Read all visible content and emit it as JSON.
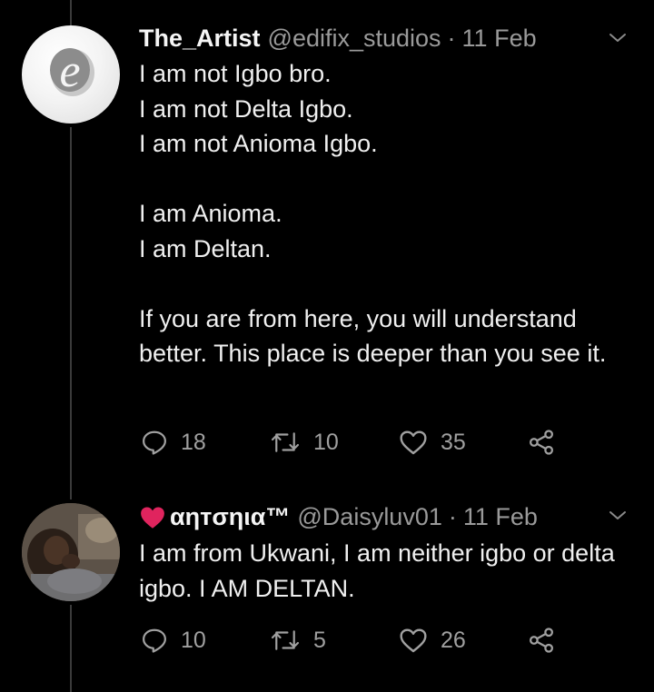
{
  "tweets": [
    {
      "display_name": "The_Artist",
      "handle": "@edifix_studios",
      "separator": "·",
      "date": "11 Feb",
      "lines": [
        "I am not Igbo bro.",
        "I am not Delta Igbo.",
        "I am not Anioma Igbo.",
        "",
        "I am Anioma.",
        "I am Deltan.",
        "",
        "If you are from here, you will understand better. This place is deeper than you see it."
      ],
      "replies": "18",
      "retweets": "10",
      "likes": "35"
    },
    {
      "display_name": "αηтσηια™",
      "handle": "@Daisyluv01",
      "separator": "·",
      "date": "11 Feb",
      "lines": [
        "I am from Ukwani, I am neither igbo or delta igbo. I AM DELTAN."
      ],
      "replies": "10",
      "retweets": "5",
      "likes": "26"
    }
  ],
  "avatar_logo_letter": "e",
  "icons": {
    "reply": "reply-icon",
    "retweet": "retweet-icon",
    "like": "heart-icon",
    "share": "share-icon",
    "menu": "chevron-down-icon",
    "heart_emoji": "red-heart-icon"
  },
  "colors": {
    "background": "#000000",
    "text": "#f0f0f0",
    "muted": "#9a9a9a",
    "heart": "#e0245e"
  }
}
